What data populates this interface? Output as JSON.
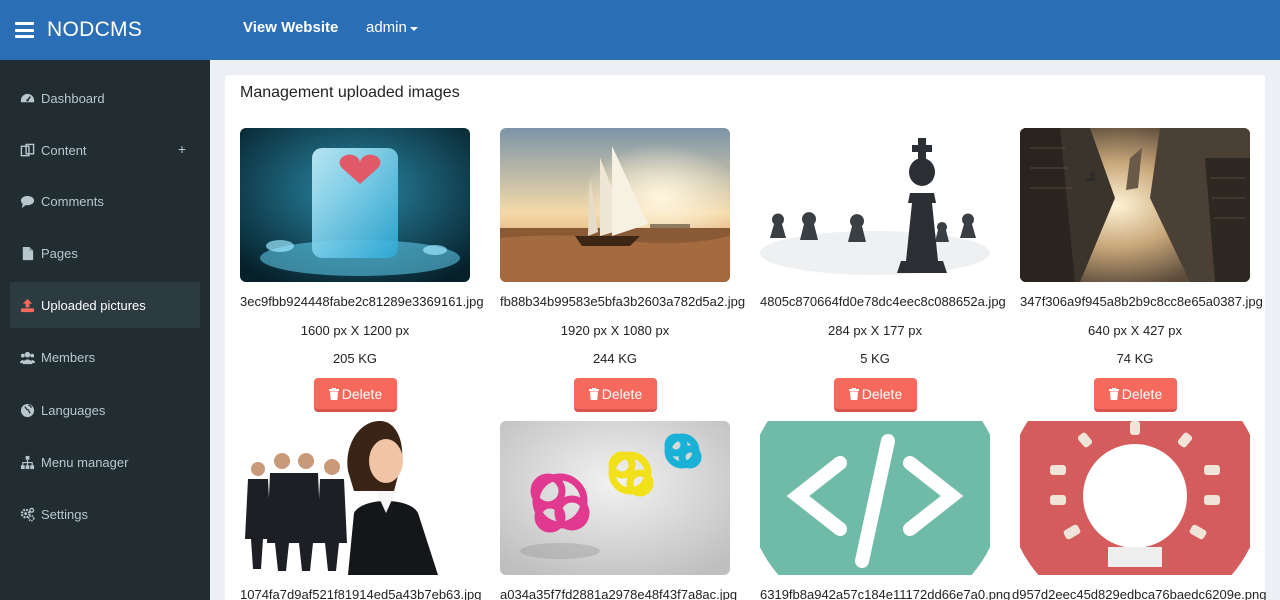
{
  "app": {
    "brand": "NODCMS"
  },
  "topnav": {
    "view_website": "View Website",
    "user": "admin"
  },
  "sidebar": {
    "items": [
      {
        "label": "Dashboard",
        "icon": "dashboard-icon"
      },
      {
        "label": "Content",
        "icon": "content-icon",
        "expand": "+"
      },
      {
        "label": "Comments",
        "icon": "comment-icon"
      },
      {
        "label": "Pages",
        "icon": "file-icon"
      },
      {
        "label": "Uploaded pictures",
        "icon": "upload-icon",
        "active": true
      },
      {
        "label": "Members",
        "icon": "users-icon"
      },
      {
        "label": "Languages",
        "icon": "globe-icon"
      },
      {
        "label": "Menu manager",
        "icon": "sitemap-icon"
      },
      {
        "label": "Settings",
        "icon": "cogs-icon"
      }
    ]
  },
  "page": {
    "title": "Management uploaded images"
  },
  "images": [
    {
      "filename": "3ec9fbb924448fabe2c81289e3369161.jpg",
      "dimensions": "1600 px X 1200 px",
      "size": "205 KG",
      "delete_label": "Delete"
    },
    {
      "filename": "fb88b34b99583e5bfa3b2603a782d5a2.jpg",
      "dimensions": "1920 px X 1080 px",
      "size": "244 KG",
      "delete_label": "Delete"
    },
    {
      "filename": "4805c870664fd0e78dc4eec8c088652a.jpg",
      "dimensions": "284 px X 177 px",
      "size": "5 KG",
      "delete_label": "Delete"
    },
    {
      "filename": "347f306a9f945a8b2b9c8cc8e65a0387.jpg",
      "dimensions": "640 px X 427 px",
      "size": "74 KG",
      "delete_label": "Delete"
    },
    {
      "filename": "1074fa7d9af521f81914ed5a43b7eb63.jpg"
    },
    {
      "filename": "a034a35f7fd2881a2978e48f43f7a8ac.jpg"
    },
    {
      "filename": "6319fb8a942a57c184e11172dd66e7a0.png"
    },
    {
      "filename": "d957d2eec45d829edbca76baedc6209e.png"
    }
  ],
  "colors": {
    "topbar": "#2a6eb5",
    "sidebar": "#222d32",
    "delete": "#f56a5c"
  }
}
